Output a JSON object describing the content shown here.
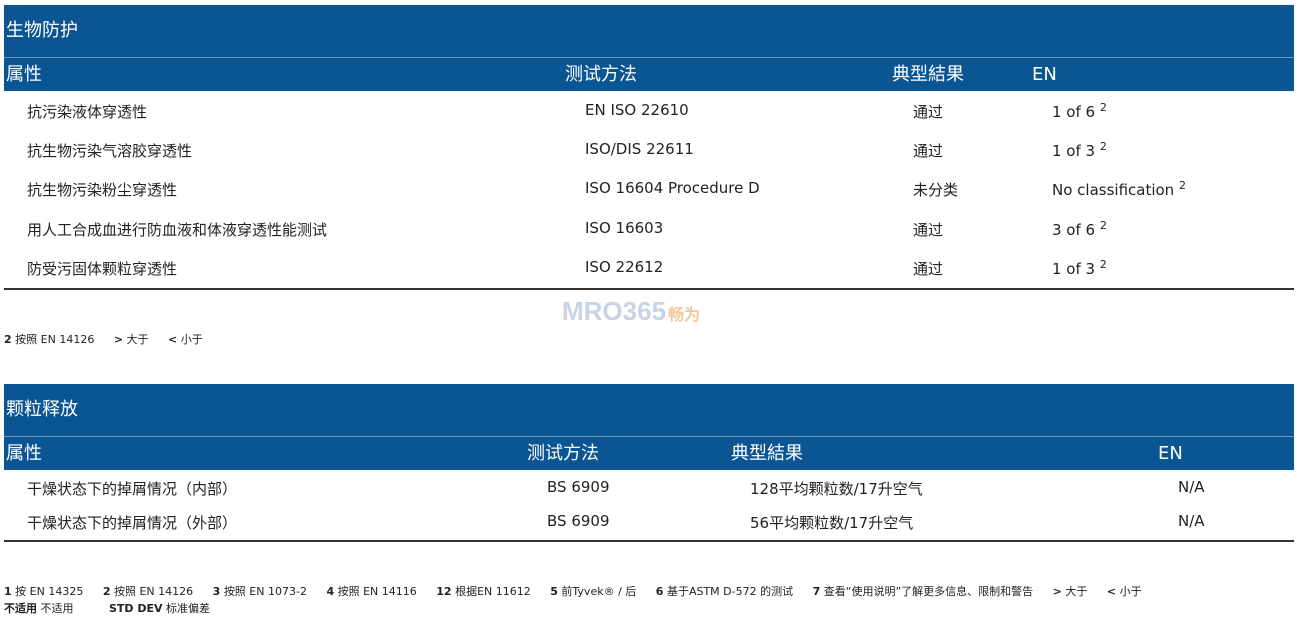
{
  "section1": {
    "title": "生物防护",
    "headers": [
      "属性",
      "测试方法",
      "典型結果",
      "EN"
    ],
    "rows": [
      {
        "prop": "抗污染液体穿透性",
        "method": "EN ISO 22610",
        "result": "通过",
        "en": "1 of 6",
        "sup": "2"
      },
      {
        "prop": "抗生物污染气溶胶穿透性",
        "method": "ISO/DIS 22611",
        "result": "通过",
        "en": "1 of 3",
        "sup": "2"
      },
      {
        "prop": "抗生物污染粉尘穿透性",
        "method": "ISO 16604 Procedure D",
        "result": "未分类",
        "en": "No classification",
        "sup": "2"
      },
      {
        "prop": "用人工合成血进行防血液和体液穿透性能测试",
        "method": "ISO 16603",
        "result": "通过",
        "en": "3 of 6",
        "sup": "2"
      },
      {
        "prop": "防受污固体颗粒穿透性",
        "method": "ISO 22612",
        "result": "通过",
        "en": "1 of 3",
        "sup": "2"
      }
    ]
  },
  "footnote1": [
    {
      "num": "2",
      "text": "按照 EN 14126"
    },
    {
      "num": ">",
      "text": "大于"
    },
    {
      "num": "<",
      "text": "小于"
    }
  ],
  "watermark": {
    "latin": "MRO365",
    "cn": "畅为"
  },
  "section2": {
    "title": "颗粒释放",
    "headers": [
      "属性",
      "测试方法",
      "典型結果",
      "EN"
    ],
    "rows": [
      {
        "prop": "干燥状态下的掉屑情况（内部）",
        "method": "BS 6909",
        "result": "128平均颗粒数/17升空气",
        "en": "N/A"
      },
      {
        "prop": "干燥状态下的掉屑情况（外部）",
        "method": "BS 6909",
        "result": "56平均颗粒数/17升空气",
        "en": "N/A"
      }
    ]
  },
  "footnote2": [
    {
      "num": "1",
      "text": "按 EN 14325"
    },
    {
      "num": "2",
      "text": "按照 EN 14126"
    },
    {
      "num": "3",
      "text": "按照 EN 1073-2"
    },
    {
      "num": "4",
      "text": "按照 EN 14116"
    },
    {
      "num": "12",
      "text": "根据EN 11612"
    },
    {
      "num": "5",
      "text": "前Tyvek® / 后"
    },
    {
      "num": "6",
      "text": "基于ASTM D-572 的测试"
    },
    {
      "num": "7",
      "text": "查看“使用说明”了解更多信息、限制和警告"
    },
    {
      "num": ">",
      "text": "大于"
    },
    {
      "num": "<",
      "text": "小于"
    }
  ],
  "footnote3": [
    {
      "num": "不适用",
      "text": "不适用"
    },
    {
      "num": "STD DEV",
      "text": "标准偏差"
    }
  ],
  "colors": {
    "header_bg": "#0b5593",
    "header_text": "#ffffff"
  }
}
